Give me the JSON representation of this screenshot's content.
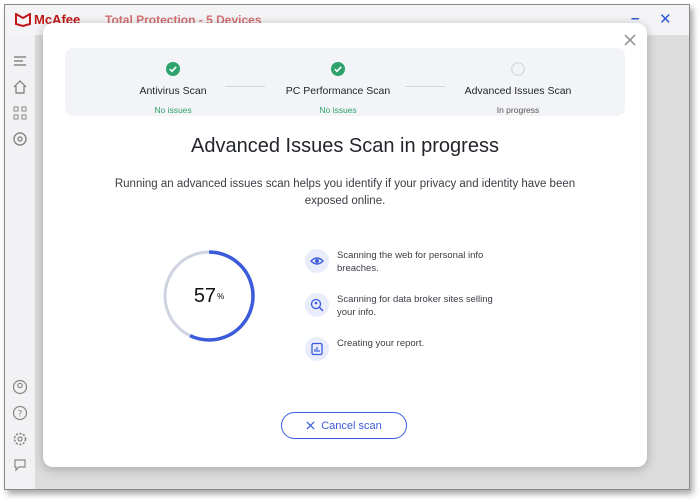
{
  "app": {
    "brand": "McAfee",
    "title": "Total Protection - 5 Devices",
    "minimize_label": "–",
    "close_label": "✕"
  },
  "sidebar": {
    "top_icons": [
      "menu-icon",
      "home-icon",
      "apps-grid-icon",
      "target-icon"
    ],
    "bottom_icons": [
      "account-icon",
      "help-icon",
      "settings-icon",
      "feedback-icon"
    ]
  },
  "steps": [
    {
      "name": "Antivirus Scan",
      "status": "No issues",
      "state": "done"
    },
    {
      "name": "PC Performance Scan",
      "status": "No issues",
      "state": "done"
    },
    {
      "name": "Advanced Issues Scan",
      "status": "In progress",
      "state": "active"
    }
  ],
  "heading": "Advanced Issues Scan in progress",
  "subtitle": "Running an advanced issues scan helps you identify if your privacy and identity have been exposed online.",
  "progress": {
    "percent": 57,
    "value_text": "57",
    "unit": "%"
  },
  "tasks": [
    {
      "icon": "eye-icon",
      "text": "Scanning the web for personal info breaches."
    },
    {
      "icon": "search-user-icon",
      "text": "Scanning for data broker sites selling your info."
    },
    {
      "icon": "report-icon",
      "text": "Creating your report."
    }
  ],
  "cancel_label": "Cancel scan",
  "colors": {
    "accent": "#3b5bdb",
    "success": "#2ea36b",
    "brand": "#c01818",
    "track": "#cfd3e2"
  }
}
